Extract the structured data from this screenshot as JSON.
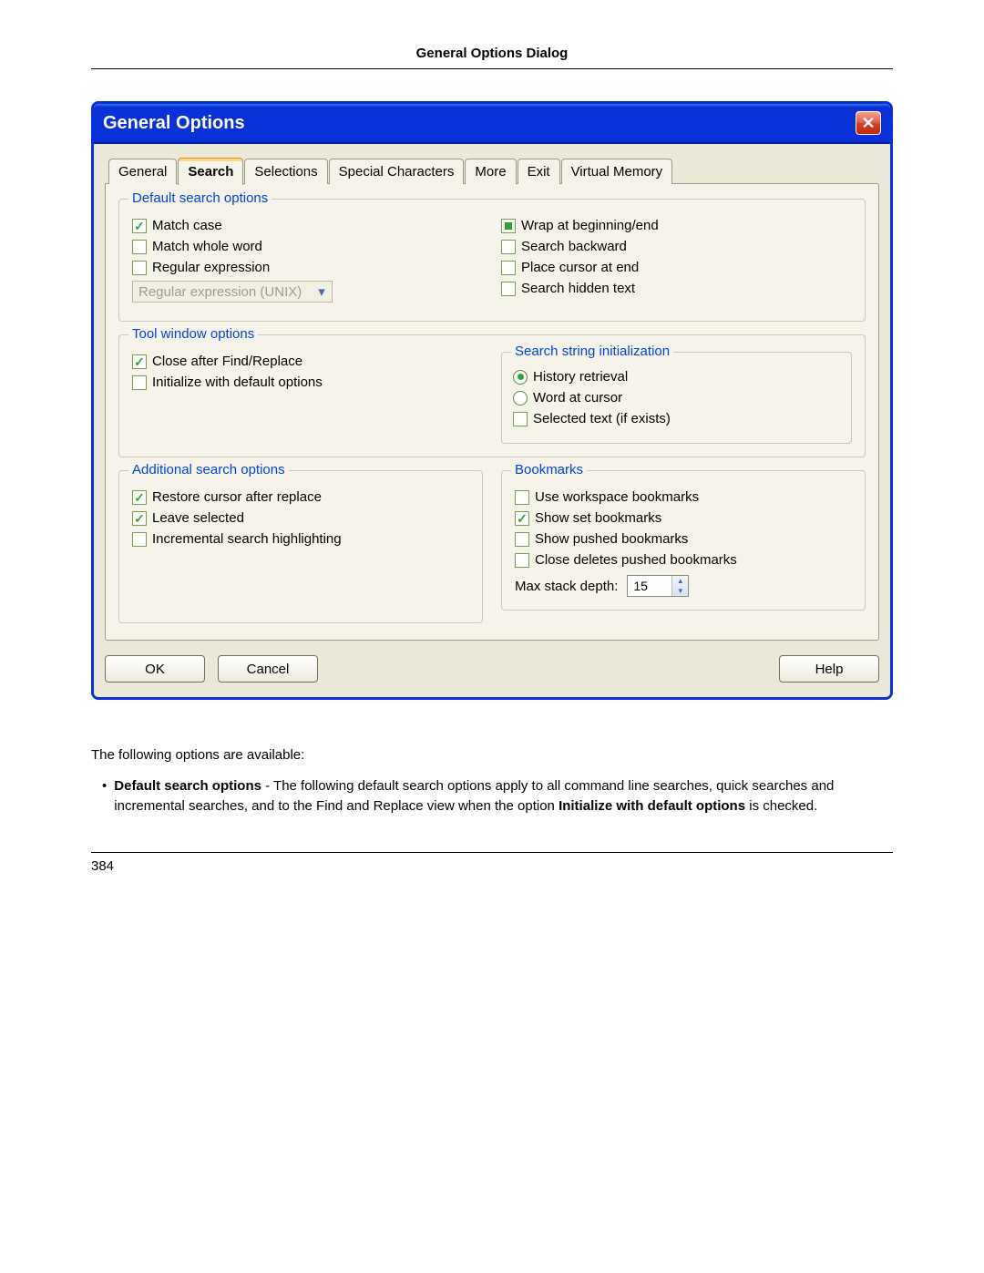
{
  "page_header": "General Options Dialog",
  "dialog_title": "General Options",
  "tabs": [
    "General",
    "Search",
    "Selections",
    "Special Characters",
    "More",
    "Exit",
    "Virtual Memory"
  ],
  "active_tab": "Search",
  "groups": {
    "default_search": {
      "legend": "Default search options",
      "items_left": [
        {
          "label": "Match case",
          "state": "checked"
        },
        {
          "label": "Match whole word",
          "state": "unchecked"
        },
        {
          "label": "Regular expression",
          "state": "unchecked"
        }
      ],
      "combo": {
        "label": "Regular expression (UNIX)",
        "enabled": false
      },
      "items_right": [
        {
          "label": "Wrap at beginning/end",
          "state": "indeterminate"
        },
        {
          "label": "Search backward",
          "state": "unchecked"
        },
        {
          "label": "Place cursor at end",
          "state": "unchecked"
        },
        {
          "label": "Search hidden text",
          "state": "unchecked"
        }
      ]
    },
    "tool_window": {
      "legend": "Tool window options",
      "items": [
        {
          "label": "Close after Find/Replace",
          "state": "checked"
        },
        {
          "label": "Initialize with default options",
          "state": "unchecked"
        }
      ],
      "nested": {
        "legend": "Search string initialization",
        "radios": [
          {
            "label": "History retrieval",
            "selected": true
          },
          {
            "label": "Word at cursor",
            "selected": false
          }
        ],
        "check": {
          "label": "Selected text (if exists)",
          "state": "unchecked"
        }
      }
    },
    "additional": {
      "legend": "Additional search options",
      "items": [
        {
          "label": "Restore cursor after replace",
          "state": "checked"
        },
        {
          "label": "Leave selected",
          "state": "checked"
        },
        {
          "label": "Incremental search highlighting",
          "state": "unchecked"
        }
      ]
    },
    "bookmarks": {
      "legend": "Bookmarks",
      "items": [
        {
          "label": "Use workspace bookmarks",
          "state": "unchecked"
        },
        {
          "label": "Show set bookmarks",
          "state": "checked"
        },
        {
          "label": "Show pushed bookmarks",
          "state": "unchecked"
        },
        {
          "label": "Close deletes pushed bookmarks",
          "state": "unchecked"
        }
      ],
      "spinner": {
        "label": "Max stack depth:",
        "value": "15"
      }
    }
  },
  "buttons": {
    "ok": "OK",
    "cancel": "Cancel",
    "help": "Help"
  },
  "doc": {
    "intro": "The following options are available:",
    "bullet_bold1": "Default search options",
    "bullet_mid": " - The following default search options apply to all command line searches, quick searches and incremental searches, and to the Find and Replace view when the option ",
    "bullet_bold2": "Initialize with default options",
    "bullet_tail": " is checked."
  },
  "page_number": "384"
}
